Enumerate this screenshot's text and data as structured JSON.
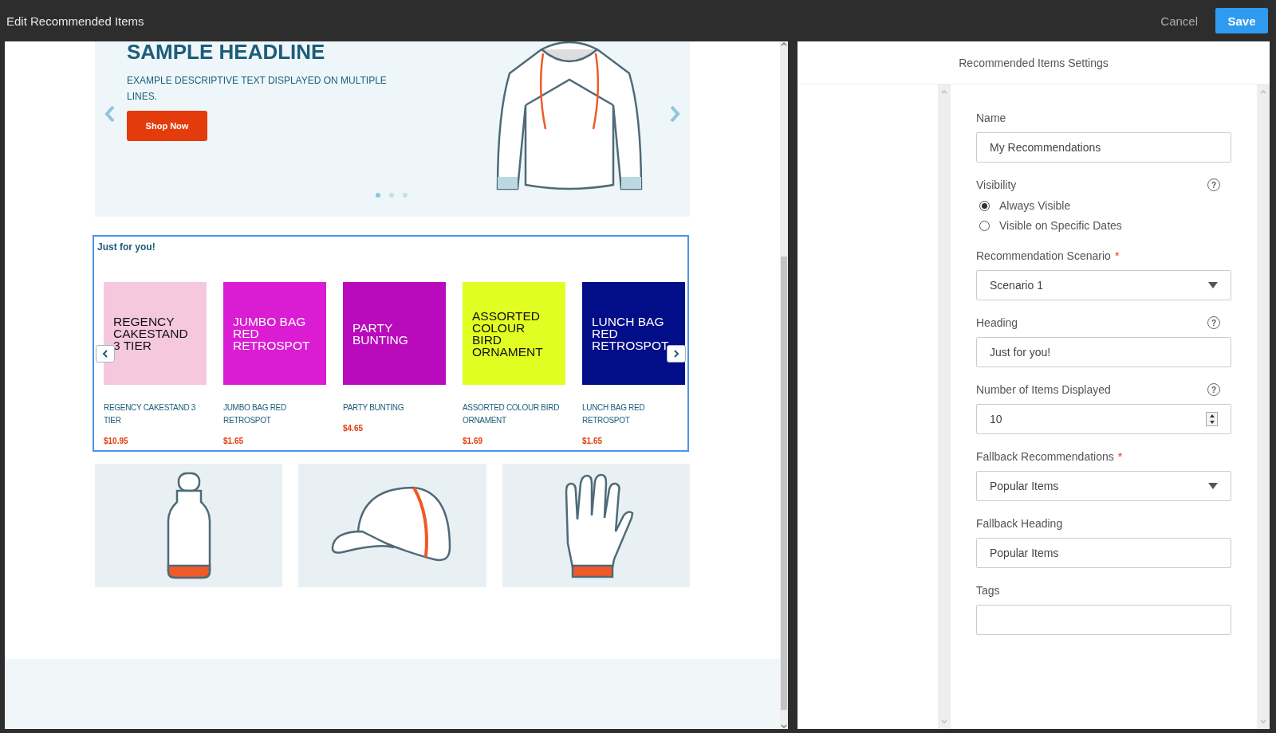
{
  "window": {
    "title": "Edit Recommended Items"
  },
  "actions": [
    {
      "label": "Cancel",
      "kind": "link"
    },
    {
      "label": "Save",
      "kind": "primary"
    }
  ],
  "preview": {
    "banner": {
      "headline": "SAMPLE HEADLINE",
      "description": "EXAMPLE DESCRIPTIVE TEXT DISPLAYED ON MULTIPLE LINES.",
      "button": "Shop Now",
      "dots": [
        {
          "selected": true
        },
        {
          "selected": false
        },
        {
          "selected": false
        }
      ]
    },
    "recommendations": {
      "heading": "Just for you!",
      "selected": true,
      "items": [
        {
          "image_text": "REGENCY CAKESTAND 3 TIER",
          "color": "#f5c8e0",
          "name": "REGENCY CAKESTAND 3 TIER",
          "price": "$10.95"
        },
        {
          "image_text": "JUMBO BAG RED RETROSPOT",
          "color": "#da1dd2",
          "name": "JUMBO BAG RED RETROSPOT",
          "price": "$1.65"
        },
        {
          "image_text": "PARTY BUNTING",
          "color": "#b90abb",
          "name": "PARTY BUNTING",
          "price": "$4.65"
        },
        {
          "image_text": "ASSORTED COLOUR BIRD ORNAMENT",
          "color": "#e2fd22",
          "name": "ASSORTED COLOUR BIRD ORNAMENT",
          "price": "$1.69"
        },
        {
          "image_text": "LUNCH BAG RED RETROSPOT",
          "color": "#020d88",
          "name": "LUNCH BAG RED RETROSPOT",
          "price": "$1.65"
        }
      ]
    },
    "tiles": [
      {
        "kind": "bottle"
      },
      {
        "kind": "cap"
      },
      {
        "kind": "glove"
      }
    ]
  },
  "settings": {
    "title": "Recommended Items Settings",
    "fields": [
      {
        "kind": "text",
        "label": "Name",
        "value": "My Recommendations"
      },
      {
        "kind": "radio",
        "label": "Visibility",
        "help_icon": "?",
        "options": [
          {
            "label": "Always Visible",
            "selected": true
          },
          {
            "label": "Visible on Specific Dates",
            "selected": false
          }
        ]
      },
      {
        "kind": "select",
        "label": "Recommendation Scenario",
        "required_mark": "*",
        "value": "Scenario 1"
      },
      {
        "kind": "text",
        "label": "Heading",
        "help_icon": "?",
        "value": "Just for you!"
      },
      {
        "kind": "number",
        "label": "Number of Items Displayed",
        "help_icon": "?",
        "value": "10"
      },
      {
        "kind": "select",
        "label": "Fallback Recommendations",
        "required_mark": "*",
        "value": "Popular Items"
      },
      {
        "kind": "text",
        "label": "Fallback Heading",
        "value": "Popular Items"
      },
      {
        "kind": "text",
        "label": "Tags"
      }
    ]
  }
}
